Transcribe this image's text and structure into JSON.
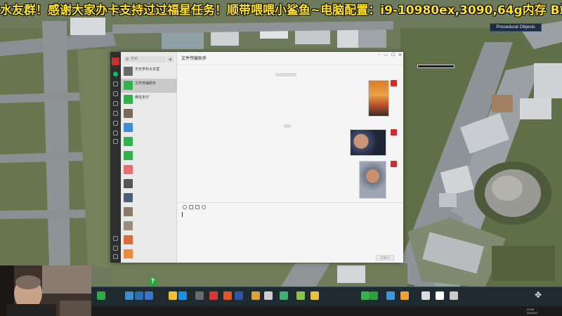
{
  "banner": {
    "text": "水友群！感谢大家办卡支持过过福星任务！顺带喂喂小鲨鱼~电脑配置：i9-10980ex,3090,64g内存 B站：杭电光"
  },
  "game": {
    "procedural_objects_label": "Procedural Objects",
    "help_badge": "?"
  },
  "wechat": {
    "search_placeholder": "搜索",
    "add_button": "+",
    "chat_title": "文件传输助手",
    "send_button": "发送(S)",
    "window_controls": [
      "···",
      "—",
      "☐",
      "✕"
    ],
    "conversations": [
      {
        "name": "天天学科大本营",
        "msg": "",
        "time": "",
        "color": "#6b6b6b"
      },
      {
        "name": "文件传输助手",
        "msg": "",
        "time": "",
        "color": "#2fb24c"
      },
      {
        "name": "微信支付",
        "msg": "",
        "time": "",
        "color": "#2fb24c"
      },
      {
        "name": "",
        "msg": "",
        "time": "",
        "color": "#7a6a5a"
      },
      {
        "name": "",
        "msg": "",
        "time": "",
        "color": "#3c8fd6"
      },
      {
        "name": "",
        "msg": "",
        "time": "",
        "color": "#2fb24c"
      },
      {
        "name": "",
        "msg": "",
        "time": "",
        "color": "#2fb24c"
      },
      {
        "name": "",
        "msg": "",
        "time": "",
        "color": "#e46f6f"
      },
      {
        "name": "",
        "msg": "",
        "time": "",
        "color": "#555555"
      },
      {
        "name": "",
        "msg": "",
        "time": "",
        "color": "#4b5f7a"
      },
      {
        "name": "",
        "msg": "",
        "time": "",
        "color": "#8a7966"
      },
      {
        "name": "",
        "msg": "",
        "time": "",
        "color": "#9c8c7c"
      },
      {
        "name": "",
        "msg": "",
        "time": "",
        "color": "#d96c3a"
      },
      {
        "name": "",
        "msg": "",
        "time": "",
        "color": "#e98b3a"
      }
    ]
  },
  "toolbar": {
    "icons": [
      "zone-icon",
      "road-icon",
      "road-alt-icon",
      "water-icon",
      "electricity-icon",
      "water-drop-icon",
      "garbage-icon",
      "health-icon",
      "fire-icon",
      "police-icon",
      "education-icon",
      "leisure-icon",
      "transport-icon",
      "landscape-icon",
      "monument-icon",
      "park-icon",
      "tree-icon",
      "district-icon",
      "bulldozer-icon",
      "pause-icon",
      "search-icon",
      "camera-icon"
    ]
  },
  "taskbar": {
    "time": "23:46",
    "date": "2022/2/1"
  }
}
